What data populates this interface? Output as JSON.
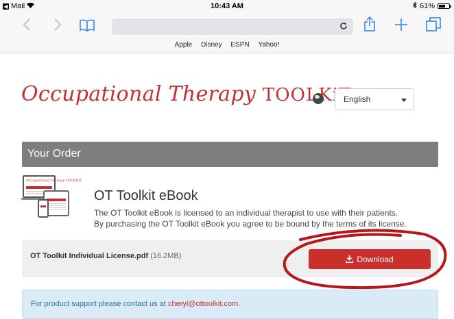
{
  "status_bar": {
    "app": "Mail",
    "time": "10:43 AM",
    "battery": "61%",
    "battery_level": 0.61
  },
  "browser": {
    "favorites": [
      "Apple",
      "Disney",
      "ESPN",
      "Yahoo!"
    ]
  },
  "header": {
    "logo_script": "Occupational Therapy ",
    "logo_caps": "TOOLKiT",
    "language": "English"
  },
  "order": {
    "heading": "Your Order",
    "product_title": "OT Toolkit eBook",
    "product_description": "The OT Toolkit eBook is licensed to an individual therapist to use with their patients. By purchasing the OT Toolkit eBook you agree to be bound by the terms of its license.",
    "thumb_title": "Occupational Therapy TOOLKIT",
    "file_name": "OT Toolkit Individual License.pdf",
    "file_size": "(16.2MB)",
    "download_label": "Download"
  },
  "support": {
    "text": "For product support please contact us at ",
    "email": "cheryl@ottoolkit.com",
    "suffix": "."
  },
  "colors": {
    "brand_red": "#c32f33",
    "button_red": "#c9302c",
    "order_bar": "#7e7e7e",
    "ios_blue": "#2d7cf6"
  }
}
